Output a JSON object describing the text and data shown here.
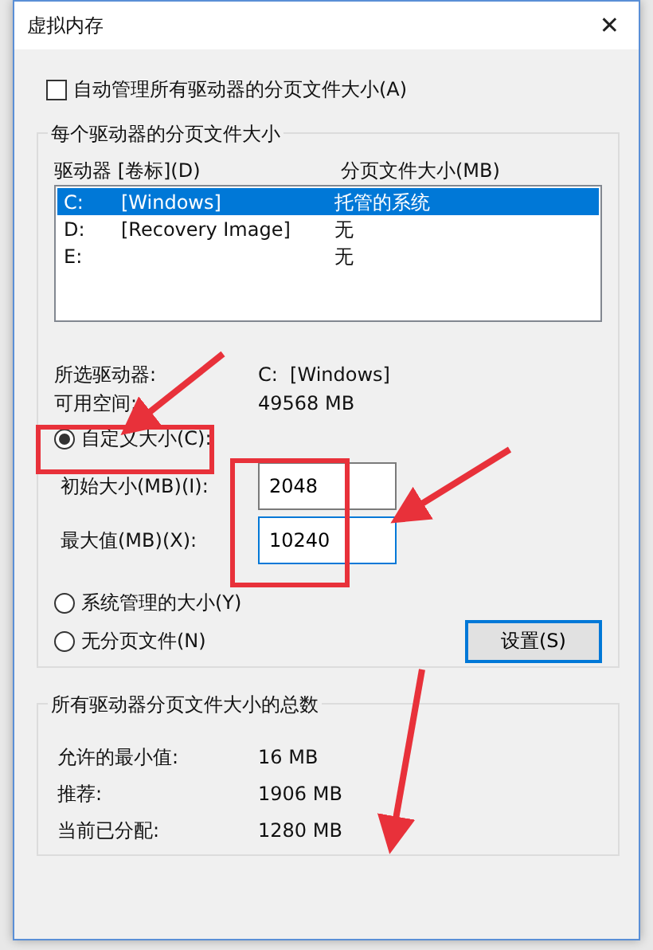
{
  "window": {
    "title": "虚拟内存",
    "close": "✕"
  },
  "auto_manage": {
    "label": "自动管理所有驱动器的分页文件大小(A)",
    "checked": false
  },
  "drives_group": {
    "title": "每个驱动器的分页文件大小",
    "columns": [
      "驱动器 [卷标](D)",
      "分页文件大小(MB)"
    ],
    "rows": [
      {
        "drive": "C:",
        "label": "[Windows]",
        "size": "托管的系统",
        "selected": true
      },
      {
        "drive": "D:",
        "label": "[Recovery Image]",
        "size": "无",
        "selected": false
      },
      {
        "drive": "E:",
        "label": "",
        "size": "无",
        "selected": false
      }
    ],
    "info": [
      {
        "label": "所选驱动器:",
        "value": "C:  [Windows]"
      },
      {
        "label": "可用空间:",
        "value": "49568 MB"
      }
    ],
    "options": [
      {
        "kind": "custom",
        "label": "自定义大小(C):",
        "selected": true,
        "fields": [
          {
            "label": "初始大小(MB)(I):",
            "value": "2048",
            "focused": false
          },
          {
            "label": "最大值(MB)(X):",
            "value": "10240",
            "focused": true
          }
        ]
      },
      {
        "kind": "plain",
        "label": "系统管理的大小(Y)",
        "selected": false
      },
      {
        "kind": "plain",
        "label": "无分页文件(N)",
        "selected": false
      }
    ],
    "set_button": "设置(S)"
  },
  "totals_group": {
    "title": "所有驱动器分页文件大小的总数",
    "rows": [
      {
        "label": "允许的最小值:",
        "value": "16 MB"
      },
      {
        "label": "推荐:",
        "value": "1906 MB"
      },
      {
        "label": "当前已分配:",
        "value": "1280 MB"
      }
    ]
  }
}
